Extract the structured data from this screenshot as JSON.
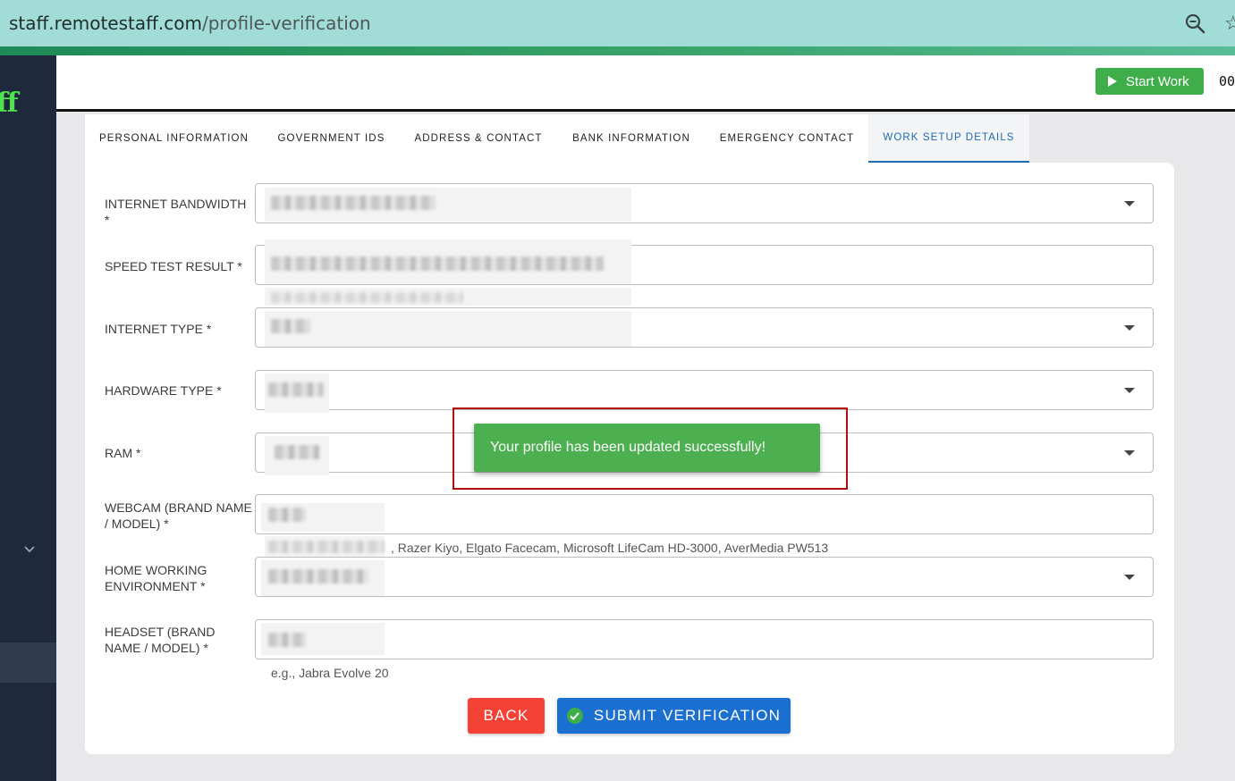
{
  "browser": {
    "url_domain": "staff.remotestaff.com",
    "url_path": "/profile-verification",
    "zoom_icon": "magnifier-minus-icon",
    "star_icon": "bookmark-star-icon"
  },
  "sidebar": {
    "logo_fragment": "ff",
    "chevron_icon": "chevron-down-icon"
  },
  "topbar": {
    "start_work_label": "Start Work",
    "play_icon": "play-icon",
    "timer_text": "00"
  },
  "tabs": [
    {
      "label": "PERSONAL INFORMATION",
      "active": false
    },
    {
      "label": "GOVERNMENT IDS",
      "active": false
    },
    {
      "label": "ADDRESS & CONTACT",
      "active": false
    },
    {
      "label": "BANK INFORMATION",
      "active": false
    },
    {
      "label": "EMERGENCY CONTACT",
      "active": false
    },
    {
      "label": "WORK SETUP DETAILS",
      "active": true
    }
  ],
  "form": {
    "internet_bandwidth": {
      "label": "INTERNET BANDWIDTH *",
      "type": "select"
    },
    "speed_test_result": {
      "label": "SPEED TEST RESULT *",
      "type": "text"
    },
    "internet_type": {
      "label": "INTERNET TYPE *",
      "type": "select"
    },
    "hardware_type": {
      "label": "HARDWARE TYPE *",
      "type": "select"
    },
    "ram": {
      "label": "RAM *",
      "type": "select"
    },
    "webcam": {
      "label": "WEBCAM (BRAND NAME / MODEL) *",
      "type": "text",
      "helper": ", Razer Kiyo, Elgato Facecam, Microsoft LifeCam HD-3000, AverMedia PW513"
    },
    "home_working_environment": {
      "label": "HOME WORKING ENVIRONMENT *",
      "type": "select"
    },
    "headset": {
      "label": "HEADSET (BRAND NAME / MODEL) *",
      "type": "text",
      "helper": "e.g., Jabra Evolve 20"
    }
  },
  "actions": {
    "back_label": "BACK",
    "submit_label": "SUBMIT VERIFICATION",
    "submit_icon": "check-circle-icon"
  },
  "toast": {
    "message": "Your profile has been updated successfully!"
  },
  "colors": {
    "browser_bar": "#a1ddd6",
    "sidebar": "#1e293b",
    "start_work": "#3fae4a",
    "active_tab": "#1e6bb8",
    "back": "#f44336",
    "submit": "#1a6fd1",
    "toast": "#4caf50",
    "highlight_box": "#b40d0d"
  }
}
